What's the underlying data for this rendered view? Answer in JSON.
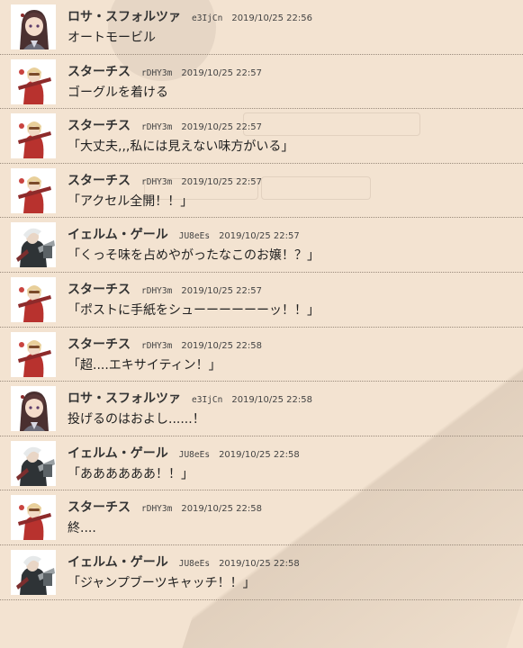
{
  "messages": [
    {
      "avatar": "rosa-avatar",
      "name": "ロサ・スフォルツァ",
      "id": "e3IjCn",
      "time": "2019/10/25 22:56",
      "text": "オートモービル"
    },
    {
      "avatar": "starchis-avatar",
      "name": "スターチス",
      "id": "rDHY3m",
      "time": "2019/10/25 22:57",
      "text": "ゴーグルを着ける"
    },
    {
      "avatar": "starchis-avatar",
      "name": "スターチス",
      "id": "rDHY3m",
      "time": "2019/10/25 22:57",
      "text": "「大丈夫,,,私には見えない味方がいる」"
    },
    {
      "avatar": "starchis-avatar",
      "name": "スターチス",
      "id": "rDHY3m",
      "time": "2019/10/25 22:57",
      "text": "「アクセル全開！！」"
    },
    {
      "avatar": "ielm-avatar",
      "name": "イェルム・ゲール",
      "id": "JU8eEs",
      "time": "2019/10/25 22:57",
      "text": "「くっそ味を占めやがったなこのお嬢！？」"
    },
    {
      "avatar": "starchis-avatar",
      "name": "スターチス",
      "id": "rDHY3m",
      "time": "2019/10/25 22:57",
      "text": "「ポストに手紙をシューーーーーーッ！！」"
    },
    {
      "avatar": "starchis-avatar",
      "name": "スターチス",
      "id": "rDHY3m",
      "time": "2019/10/25 22:58",
      "text": "「超....エキサイティン！」"
    },
    {
      "avatar": "rosa-avatar",
      "name": "ロサ・スフォルツァ",
      "id": "e3IjCn",
      "time": "2019/10/25 22:58",
      "text": "投げるのはおよし......！"
    },
    {
      "avatar": "ielm-avatar",
      "name": "イェルム・ゲール",
      "id": "JU8eEs",
      "time": "2019/10/25 22:58",
      "text": "「ああああああ！！」"
    },
    {
      "avatar": "starchis-avatar",
      "name": "スターチス",
      "id": "rDHY3m",
      "time": "2019/10/25 22:58",
      "text": "終...."
    },
    {
      "avatar": "ielm-avatar",
      "name": "イェルム・ゲール",
      "id": "JU8eEs",
      "time": "2019/10/25 22:58",
      "text": "「ジャンプブーツキャッチ！！」"
    }
  ]
}
